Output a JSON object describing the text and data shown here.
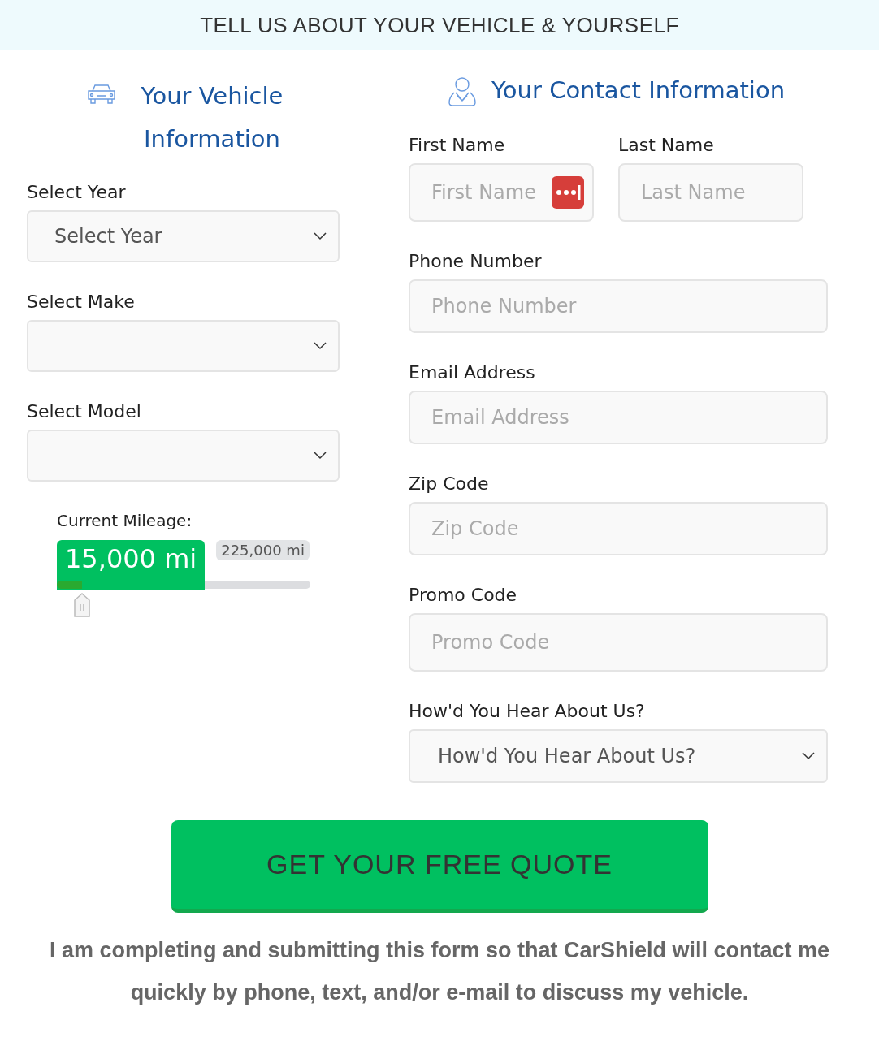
{
  "banner": "TELL US ABOUT YOUR VEHICLE & YOURSELF",
  "vehicle": {
    "heading": "Your Vehicle Information",
    "selects": [
      {
        "label": "Select Year",
        "value": "Select Year"
      },
      {
        "label": "Select Make"
      },
      {
        "label": "Select Model"
      }
    ],
    "mileage": {
      "label": "Current Mileage:",
      "reading": "15,000 mi",
      "max_label": "225,000 mi",
      "level": 0.1
    }
  },
  "contact": {
    "heading": "Your Contact Information",
    "name_fields": [
      {
        "label": "First Name",
        "placeholder": "First Name",
        "password_badge": true
      },
      {
        "label": "Last Name",
        "placeholder": "Last Name",
        "password_badge": false
      }
    ],
    "fields": [
      {
        "kind": "input",
        "label": "Phone Number",
        "placeholder": "Phone Number"
      },
      {
        "kind": "input",
        "label": "Email Address",
        "placeholder": "Email Address"
      },
      {
        "kind": "input",
        "label": "Zip Code",
        "placeholder": "Zip Code"
      },
      {
        "kind": "input",
        "label": "Promo Code",
        "placeholder": "Promo Code"
      },
      {
        "kind": "select",
        "label": "How'd You Hear About Us?",
        "value": "How'd You Hear About Us?"
      }
    ]
  },
  "submit": "GET YOUR FREE QUOTE",
  "disclaimer": "I am completing and submitting this form so that CarShield will contact me quickly by phone, text, and/or e-mail to discuss my vehicle."
}
